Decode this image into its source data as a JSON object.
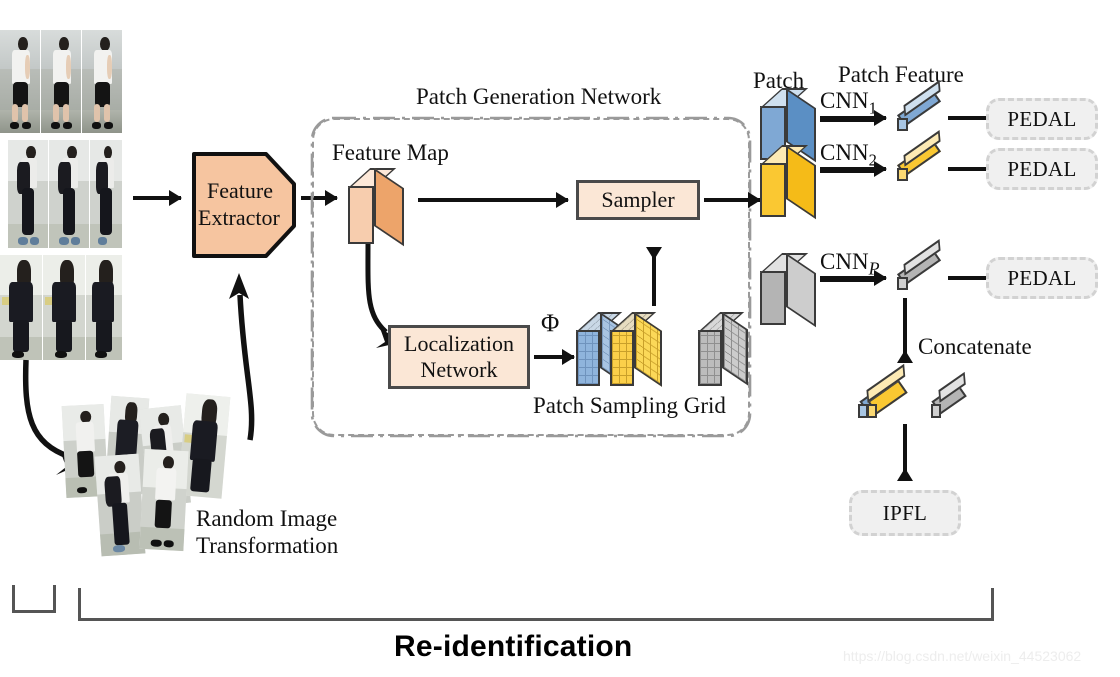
{
  "figure": {
    "title": "Re-identification",
    "watermark": "https://blog.csdn.net/weixin_44523062"
  },
  "labels": {
    "patch_generation_network": "Patch Generation Network",
    "feature_map": "Feature Map",
    "patch_sampling_grid": "Patch Sampling Grid",
    "random_image_transformation_line1": "Random Image",
    "random_image_transformation_line2": "Transformation",
    "patch": "Patch",
    "patch_feature": "Patch Feature",
    "concatenate": "Concatenate",
    "phi": "Φ"
  },
  "blocks": {
    "feature_extractor_line1": "Feature",
    "feature_extractor_line2": "Extractor",
    "sampler": "Sampler",
    "localization_line1": "Localization",
    "localization_line2": "Network",
    "ipfl": "IPFL"
  },
  "branches": [
    {
      "cnn": "CNN",
      "cnn_sub": "1",
      "cnn_sub_italic": false,
      "head": "PEDAL",
      "color": "#6f9fd8"
    },
    {
      "cnn": "CNN",
      "cnn_sub": "2",
      "cnn_sub_italic": false,
      "head": "PEDAL",
      "color": "#fac832"
    },
    {
      "cnn": "CNN",
      "cnn_sub": "P",
      "cnn_sub_italic": true,
      "head": "PEDAL",
      "color": "#b4b4b4"
    }
  ],
  "colors": {
    "salmon_fill": "#f6c5a0",
    "cream_fill": "#fbe7d6",
    "blue_front": "#7fa8d4",
    "blue_light": "#c3d8ec",
    "yellow_front": "#fac832",
    "yellow_light": "#fde6a8",
    "gray_front": "#b4b4b4",
    "gray_light": "#dcdcdc",
    "outline": "#3a3a3a",
    "capsule_fill": "#f0f0f0",
    "capsule_border": "#d2d2d2",
    "container_border": "#9a9a9a",
    "bracket": "#555555"
  }
}
